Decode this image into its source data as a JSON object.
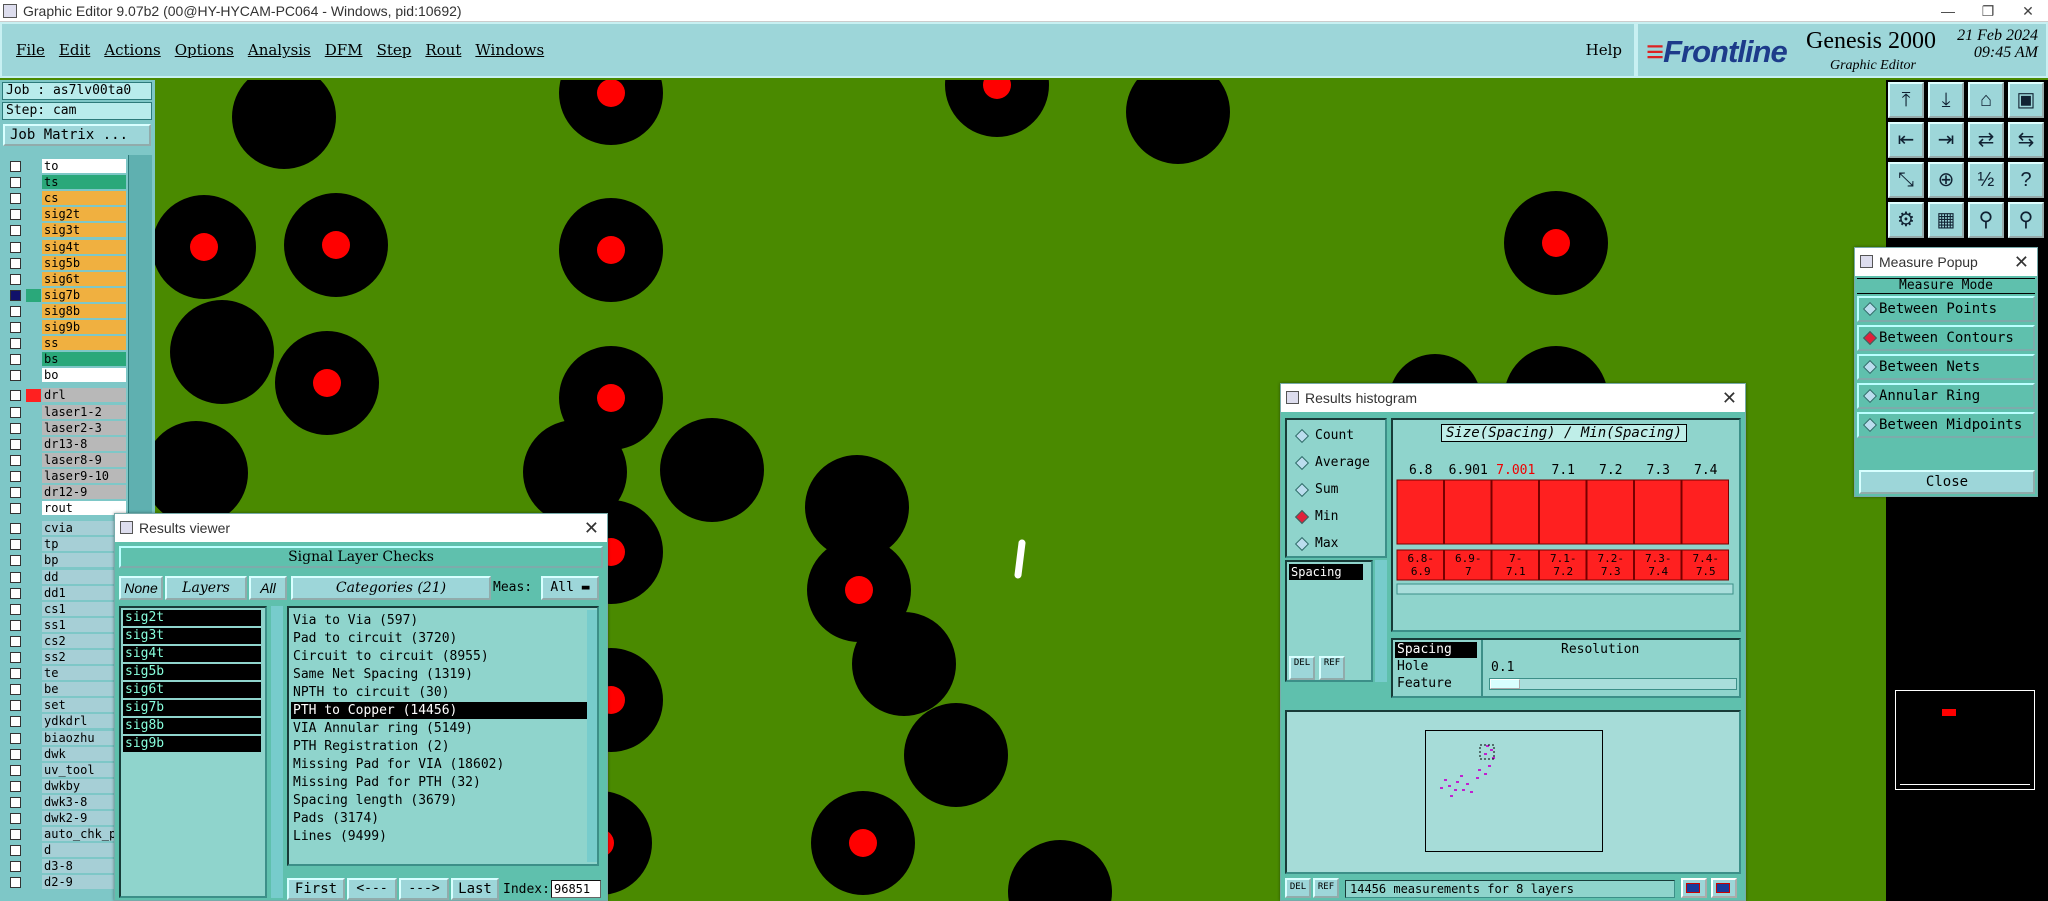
{
  "titlebar": {
    "title": "Graphic Editor 9.07b2 (00@HY-HYCAM-PC064 - Windows, pid:10692)"
  },
  "menu": {
    "items": [
      "File",
      "Edit",
      "Actions",
      "Options",
      "Analysis",
      "DFM",
      "Step",
      "Rout",
      "Windows"
    ],
    "help": "Help"
  },
  "brand": {
    "logo": "Frontline",
    "product": "Genesis 2000",
    "subtitle": "Graphic Editor",
    "date": "21 Feb 2024",
    "time": "09:45 AM"
  },
  "job": {
    "job_label": "Job : as7lv00ta0",
    "step_label": "Step: cam",
    "matrix_button": "Job Matrix ..."
  },
  "layers": [
    {
      "name": "to",
      "color": "#ffffff",
      "selected": false
    },
    {
      "name": "ts",
      "color": "#2aa87a",
      "selected": false
    },
    {
      "name": "cs",
      "color": "#f0b040",
      "selected": false
    },
    {
      "name": "sig2t",
      "color": "#f0b040",
      "selected": false
    },
    {
      "name": "sig3t",
      "color": "#f0b040",
      "selected": false
    },
    {
      "name": "sig4t",
      "color": "#f0b040",
      "selected": false
    },
    {
      "name": "sig5b",
      "color": "#f0b040",
      "selected": false
    },
    {
      "name": "sig6t",
      "color": "#f0b040",
      "selected": false
    },
    {
      "name": "sig7b",
      "color": "#f0b040",
      "selected": true
    },
    {
      "name": "sig8b",
      "color": "#f0b040",
      "selected": false
    },
    {
      "name": "sig9b",
      "color": "#f0b040",
      "selected": false
    },
    {
      "name": "ss",
      "color": "#f0b040",
      "selected": false
    },
    {
      "name": "bs",
      "color": "#2aa87a",
      "selected": false
    },
    {
      "name": "bo",
      "color": "#ffffff",
      "selected": false
    },
    {
      "name": "drl",
      "color": "#b8b8b8",
      "selected": false
    },
    {
      "name": "laser1-2",
      "color": "#b8b8b8",
      "selected": false
    },
    {
      "name": "laser2-3",
      "color": "#b8b8b8",
      "selected": false
    },
    {
      "name": "dr13-8",
      "color": "#b8b8b8",
      "selected": false
    },
    {
      "name": "laser8-9",
      "color": "#b8b8b8",
      "selected": false
    },
    {
      "name": "laser9-10",
      "color": "#b8b8b8",
      "selected": false
    },
    {
      "name": "dr12-9",
      "color": "#b8b8b8",
      "selected": false
    },
    {
      "name": "rout",
      "color": "#ffffff",
      "selected": false
    },
    {
      "name": "cvia",
      "color": "#a6cfd6",
      "selected": false
    },
    {
      "name": "tp",
      "color": "#a6cfd6",
      "selected": false
    },
    {
      "name": "bp",
      "color": "#a6cfd6",
      "selected": false
    },
    {
      "name": "dd",
      "color": "#a6cfd6",
      "selected": false
    },
    {
      "name": "dd1",
      "color": "#a6cfd6",
      "selected": false
    },
    {
      "name": "cs1",
      "color": "#a6cfd6",
      "selected": false
    },
    {
      "name": "ss1",
      "color": "#a6cfd6",
      "selected": false
    },
    {
      "name": "cs2",
      "color": "#a6cfd6",
      "selected": false
    },
    {
      "name": "ss2",
      "color": "#a6cfd6",
      "selected": false
    },
    {
      "name": "te",
      "color": "#a6cfd6",
      "selected": false
    },
    {
      "name": "be",
      "color": "#a6cfd6",
      "selected": false
    },
    {
      "name": "set",
      "color": "#a6cfd6",
      "selected": false
    },
    {
      "name": "ydkdrl",
      "color": "#a6cfd6",
      "selected": false
    },
    {
      "name": "biaozhu",
      "color": "#a6cfd6",
      "selected": false
    },
    {
      "name": "dwk",
      "color": "#a6cfd6",
      "selected": false
    },
    {
      "name": "uv_tool",
      "color": "#a6cfd6",
      "selected": false
    },
    {
      "name": "dwkby",
      "color": "#a6cfd6",
      "selected": false
    },
    {
      "name": "dwk3-8",
      "color": "#a6cfd6",
      "selected": false
    },
    {
      "name": "dwk2-9",
      "color": "#a6cfd6",
      "selected": false
    },
    {
      "name": "auto_chk_p",
      "color": "#a6cfd6",
      "selected": false
    },
    {
      "name": "d",
      "color": "#a6cfd6",
      "selected": false
    },
    {
      "name": "d3-8",
      "color": "#a6cfd6",
      "selected": false
    },
    {
      "name": "d2-9",
      "color": "#a6cfd6",
      "selected": false
    }
  ],
  "results_viewer": {
    "title": "Results viewer",
    "header": "Signal Layer Checks",
    "none_btn": "None",
    "layers_btn": "Layers",
    "all_btn": "All",
    "categories_btn": "Categories (21)",
    "meas_label": "Meas:",
    "meas_value": "All",
    "layer_list": [
      "sig2t",
      "sig3t",
      "sig4t",
      "sig5b",
      "sig6t",
      "sig7b",
      "sig8b",
      "sig9b"
    ],
    "categories": [
      "Via to Via (597)",
      "Pad to circuit (3720)",
      "Circuit to circuit (8955)",
      "Same Net Spacing (1319)",
      "NPTH to circuit (30)",
      "PTH to Copper (14456)",
      "VIA Annular ring (5149)",
      "PTH Registration (2)",
      "Missing Pad for VIA (18602)",
      "Missing Pad for PTH (32)",
      "Spacing length (3679)",
      "Pads (3174)",
      "Lines (9499)"
    ],
    "selected_category": 5,
    "first": "First",
    "prev": "<---",
    "next": "--->",
    "last": "Last",
    "index_label": "Index:",
    "index_value": "96851"
  },
  "histogram": {
    "title": "Results histogram",
    "options": [
      {
        "label": "Count",
        "on": false
      },
      {
        "label": "Average",
        "on": false
      },
      {
        "label": "Sum",
        "on": false
      },
      {
        "label": "Min",
        "on": true
      },
      {
        "label": "Max",
        "on": false
      }
    ],
    "heading": "Size(Spacing) / Min(Spacing)",
    "values": [
      "6.8",
      "6.901",
      "7.001",
      "7.1",
      "7.2",
      "7.3",
      "7.4"
    ],
    "value_levels": [
      0.85,
      0.85,
      0.85,
      0.85,
      0.85,
      0.85,
      0.85
    ],
    "ranges": [
      "6.8-\n6.9",
      "6.9-\n7",
      "7-\n7.1",
      "7.1-\n7.2",
      "7.2-\n7.3",
      "7.3-\n7.4",
      "7.4-\n7.5"
    ],
    "attr_box": "Spacing",
    "del": "DEL",
    "ref": "REF",
    "attr_list": [
      "Spacing",
      "Hole",
      "Feature"
    ],
    "resolution_label": "Resolution",
    "resolution_value": "0.1",
    "status": "14456 measurements for 8 layers"
  },
  "measure": {
    "title": "Measure Popup",
    "header": "Measure Mode",
    "options": [
      {
        "label": "Between Points",
        "on": false
      },
      {
        "label": "Between Contours",
        "on": true
      },
      {
        "label": "Between Nets",
        "on": false
      },
      {
        "label": "Annular Ring",
        "on": false
      },
      {
        "label": "Between Midpoints",
        "on": false
      }
    ],
    "close": "Close"
  },
  "toolbar_icons": [
    "zoom-home-icon",
    "zoom-in-icon",
    "zoom-out-icon",
    "zoom-window-icon",
    "pan-left-icon",
    "pan-right-icon",
    "zoom-fit-icon",
    "zoom-sel-icon",
    "zoom-in-icon2",
    "zoom-out-icon2",
    "ratio-icon",
    "help-icon",
    "settings-icon",
    "grid-icon",
    "snap-icon",
    "snap2-icon"
  ],
  "toolbar_glyphs": [
    "⤒",
    "⤓",
    "⌂",
    "▣",
    "⇤",
    "⇥",
    "⇄",
    "⇆",
    "⤡",
    "⊕",
    "½",
    "?",
    "⚙",
    "▦",
    "⚲",
    "⚲"
  ],
  "colors": {
    "board": "#4a8a00",
    "pad": "#000000",
    "drill": "#ff0000",
    "panel": "#5fc0ad",
    "accent": "#e0203a"
  }
}
